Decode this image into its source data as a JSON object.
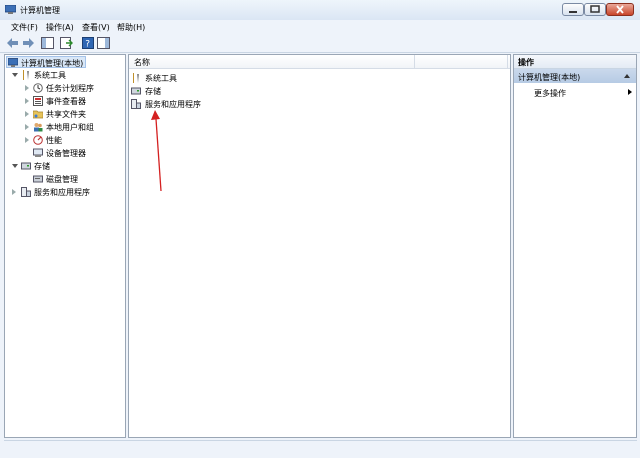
{
  "window": {
    "title": "计算机管理"
  },
  "menu": [
    "文件(F)",
    "操作(A)",
    "查看(V)",
    "帮助(H)"
  ],
  "tree": {
    "root": "计算机管理(本地)",
    "system_tools": "系统工具",
    "task_scheduler": "任务计划程序",
    "event_viewer": "事件查看器",
    "shared_folders": "共享文件夹",
    "local_users": "本地用户和组",
    "performance": "性能",
    "device_manager": "设备管理器",
    "storage": "存储",
    "disk_management": "磁盘管理",
    "services_apps": "服务和应用程序"
  },
  "center": {
    "column_name": "名称",
    "items": [
      "系统工具",
      "存储",
      "服务和应用程序"
    ]
  },
  "actions": {
    "header": "操作",
    "section": "计算机管理(本地)",
    "more": "更多操作"
  },
  "colors": {
    "annotation_arrow": "#d42020",
    "selection": "#d9e7f7"
  }
}
